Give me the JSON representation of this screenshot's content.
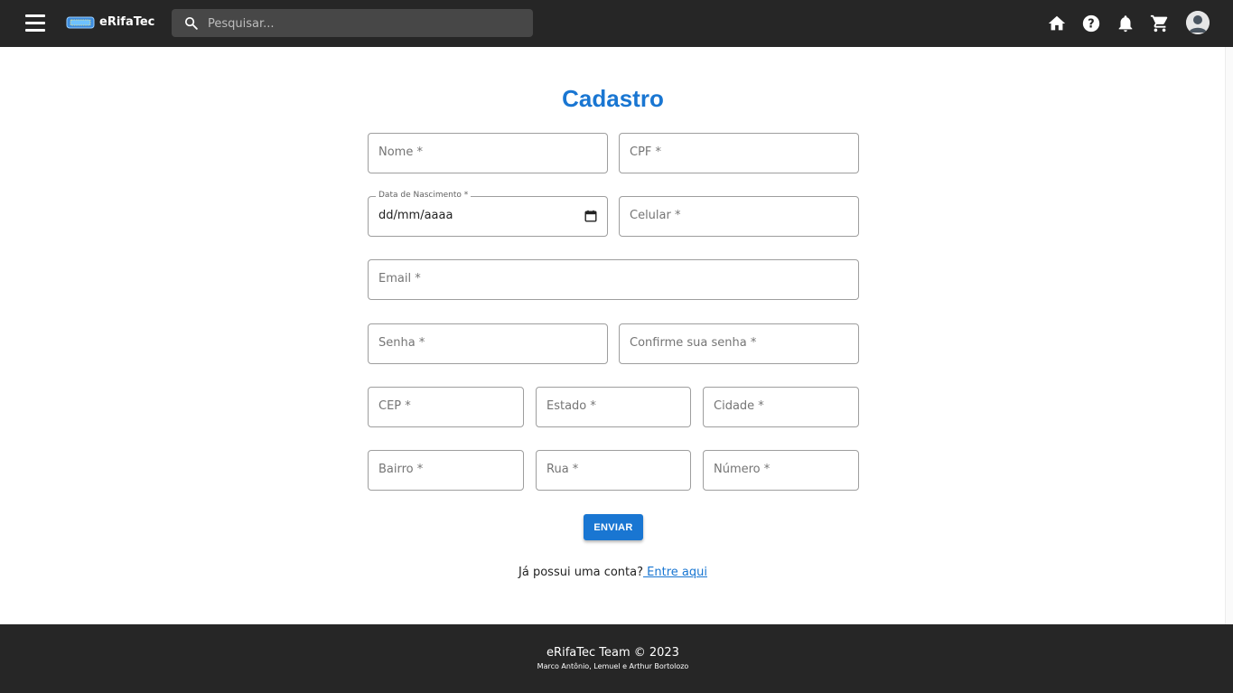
{
  "header": {
    "brand": "eRifaTec",
    "search_placeholder": "Pesquisar...",
    "icons": [
      "menu-icon",
      "ticket-logo-icon",
      "search-icon",
      "home-icon",
      "help-icon",
      "bell-icon",
      "cart-icon",
      "account-avatar"
    ]
  },
  "form": {
    "title": "Cadastro",
    "fields": {
      "nome": "Nome *",
      "cpf": "CPF *",
      "data_nascimento_label": "Data de Nascimento *",
      "data_nascimento_value": "dd/mm/aaaa",
      "celular": "Celular *",
      "email": "Email *",
      "senha": "Senha *",
      "confirme_senha": "Confirme sua senha *",
      "cep": "CEP *",
      "estado": "Estado *",
      "cidade": "Cidade *",
      "bairro": "Bairro *",
      "rua": "Rua *",
      "numero": "Número *"
    },
    "submit_label": "ENVIAR",
    "login_prompt": "Já possui uma conta?",
    "login_link": " Entre aqui"
  },
  "footer": {
    "line1": "eRifaTec Team © 2023",
    "line2": "Marco Antônio, Lemuel e Arthur Bortolozo"
  },
  "colors": {
    "topbar": "#262626",
    "accent": "#1976d2",
    "search_bg": "#474747"
  }
}
